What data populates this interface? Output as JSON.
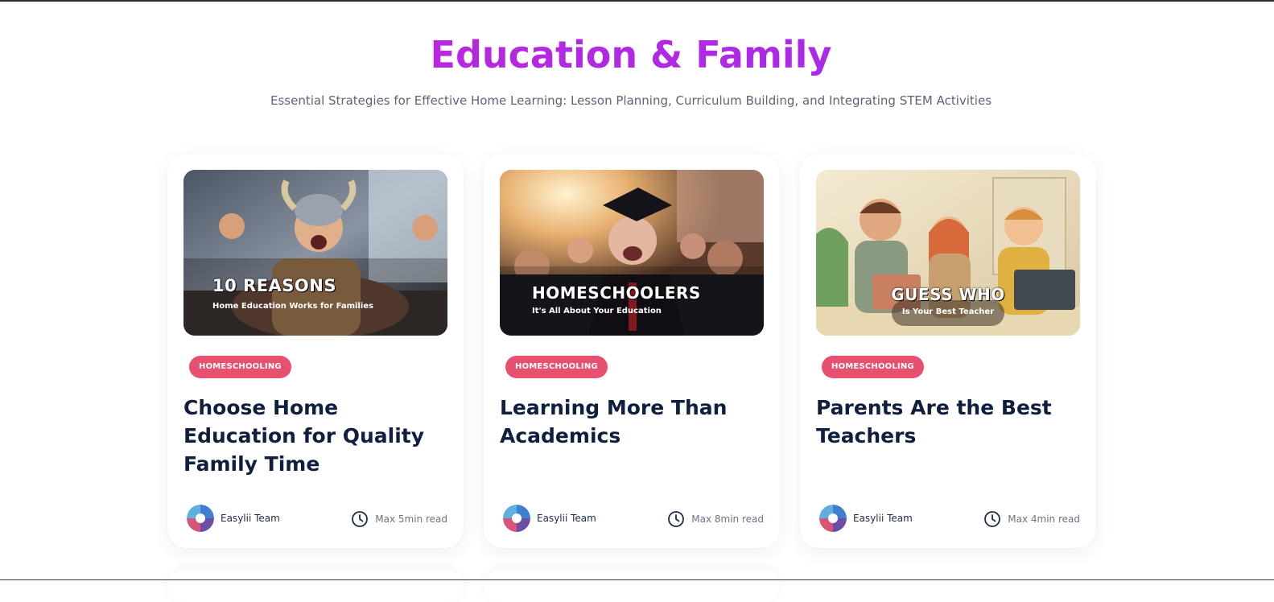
{
  "header": {
    "title": "Education & Family",
    "subtitle": "Essential Strategies for Effective Home Learning: Lesson Planning, Curriculum Building, and Integrating STEM Activities"
  },
  "colors": {
    "title_gradient_start": "#c724d6",
    "title_gradient_end": "#9b2ef0",
    "badge": "#e8506f",
    "card_title": "#0f1f3d"
  },
  "cards": [
    {
      "image_title": "10 REASONS",
      "image_subtitle": "Home Education Works for Families",
      "category": "HOMESCHOOLING",
      "title": "Choose Home Education for Quality Family Time",
      "author": "Easylii Team",
      "read_time": "Max 5min read",
      "avatar_icon": "avatar-logo",
      "time_icon": "clock-icon"
    },
    {
      "image_title": "HOMESCHOOLERS",
      "image_subtitle": "It's All About Your Education",
      "category": "HOMESCHOOLING",
      "title": "Learning More Than Academics",
      "author": "Easylii Team",
      "read_time": "Max 8min read",
      "avatar_icon": "avatar-logo",
      "time_icon": "clock-icon"
    },
    {
      "image_title": "GUESS WHO",
      "image_subtitle": "Is Your Best Teacher",
      "category": "HOMESCHOOLING",
      "title": "Parents Are the Best Teachers",
      "author": "Easylii Team",
      "read_time": "Max 4min read",
      "avatar_icon": "avatar-logo",
      "time_icon": "clock-icon"
    }
  ]
}
